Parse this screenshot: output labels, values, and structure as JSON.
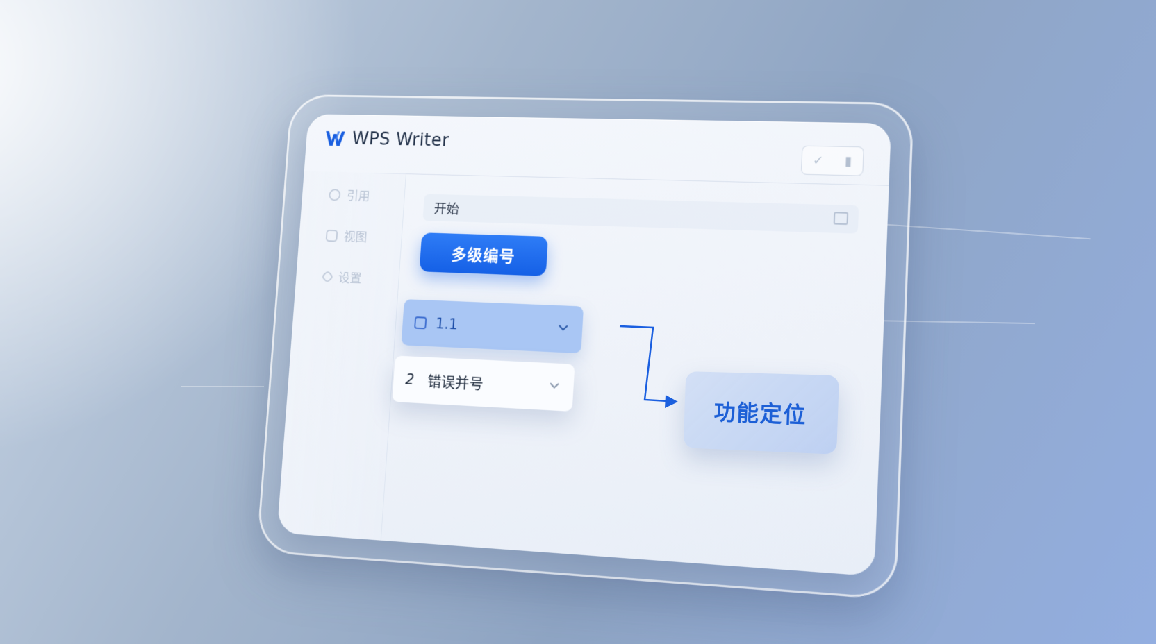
{
  "app": {
    "title": "WPS Writer",
    "logo_icon": "wps-w-logo-icon"
  },
  "window_controls": {
    "icons": [
      "check-icon",
      "document-icon"
    ]
  },
  "sidebar": {
    "items": [
      {
        "label": "引用",
        "icon": "circle-icon"
      },
      {
        "label": "视图",
        "icon": "image-icon"
      },
      {
        "label": "设置",
        "icon": "diamond-icon"
      }
    ]
  },
  "ribbon": {
    "label": "开始",
    "icon": "panel-icon"
  },
  "main": {
    "primary_button": "多级编号",
    "select_1": {
      "value": "1.1",
      "icon": "list-icon"
    },
    "select_2": {
      "number": "2",
      "value": "错误并号"
    }
  },
  "callout": {
    "label": "功能定位"
  },
  "colors": {
    "accent": "#1560e6",
    "selected_bg": "#a9c6f4",
    "callout_text": "#1c5fd6"
  }
}
